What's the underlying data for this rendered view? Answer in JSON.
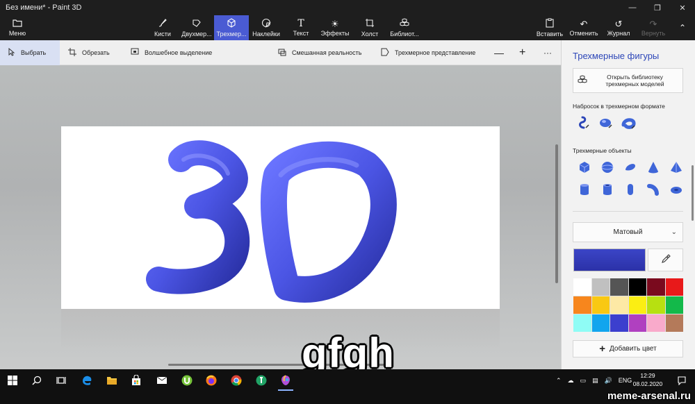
{
  "window": {
    "title": "Без имени* - Paint 3D",
    "controls": [
      "minimize-icon",
      "restore-icon",
      "close-icon"
    ]
  },
  "ribbon": {
    "menu_label": "Меню",
    "tools": [
      {
        "label": "Кисти",
        "icon": "brush-icon",
        "active": false
      },
      {
        "label": "Двухмер...",
        "icon": "2d-shapes-icon",
        "active": false
      },
      {
        "label": "Трехмер...",
        "icon": "3d-shapes-icon",
        "active": true
      },
      {
        "label": "Наклейки",
        "icon": "stickers-icon",
        "active": false
      },
      {
        "label": "Текст",
        "icon": "text-icon",
        "active": false
      },
      {
        "label": "Эффекты",
        "icon": "effects-icon",
        "active": false
      },
      {
        "label": "Холст",
        "icon": "canvas-icon",
        "active": false
      },
      {
        "label": "Библиот...",
        "icon": "library-icon",
        "active": false
      }
    ],
    "right": {
      "paste": "Вставить",
      "undo": "Отменить",
      "history": "Журнал",
      "redo": "Вернуть"
    }
  },
  "subbar": {
    "select": "Выбрать",
    "crop": "Обрезать",
    "magic_select": "Волшебное выделение",
    "mixed_reality": "Смешанная реальность",
    "view_3d": "Трехмерное представление",
    "zoom_out": "—",
    "zoom_in": "+",
    "more": "···"
  },
  "canvas": {
    "art_text": "3D",
    "art_color": "#4a55e0"
  },
  "panel": {
    "title": "Трехмерные фигуры",
    "library_button": "Открыть библиотеку трехмерных моделей",
    "doodle_label": "Набросок в трехмерном формате",
    "objects_label": "Трехмерные объекты",
    "doodles": [
      "sharp-doodle-icon",
      "soft-doodle-icon",
      "tube-doodle-icon"
    ],
    "objects": [
      "cube-icon",
      "sphere-icon",
      "hemisphere-icon",
      "cone-icon",
      "pyramid-icon",
      "cylinder-icon",
      "tube-icon",
      "capsule-icon",
      "pipe-bend-icon",
      "donut-icon"
    ],
    "material": "Матовый",
    "current_color": "#3a44c4",
    "palette": [
      "#ffffff",
      "#c0c0c0",
      "#555555",
      "#000000",
      "#7a0a1e",
      "#e8191a",
      "#f7861d",
      "#f9c812",
      "#fde9a5",
      "#fbee13",
      "#b7e011",
      "#13b94a",
      "#8ffcf5",
      "#12a5ee",
      "#3c3fce",
      "#b040c0",
      "#f9aacb",
      "#b47a5a"
    ],
    "add_color": "Добавить цвет"
  },
  "taskbar": {
    "apps": [
      "windows-start-icon",
      "search-icon",
      "task-view-icon",
      "edge-icon",
      "file-explorer-icon",
      "store-icon",
      "mail-icon",
      "utorrent-icon",
      "firefox-icon",
      "chrome-icon",
      "green-app-icon",
      "paint3d-icon"
    ],
    "lang": "ENG",
    "time": "12:29",
    "date": "08.02.2020"
  },
  "caption": "gfgh",
  "watermark": "meme-arsenal.ru"
}
